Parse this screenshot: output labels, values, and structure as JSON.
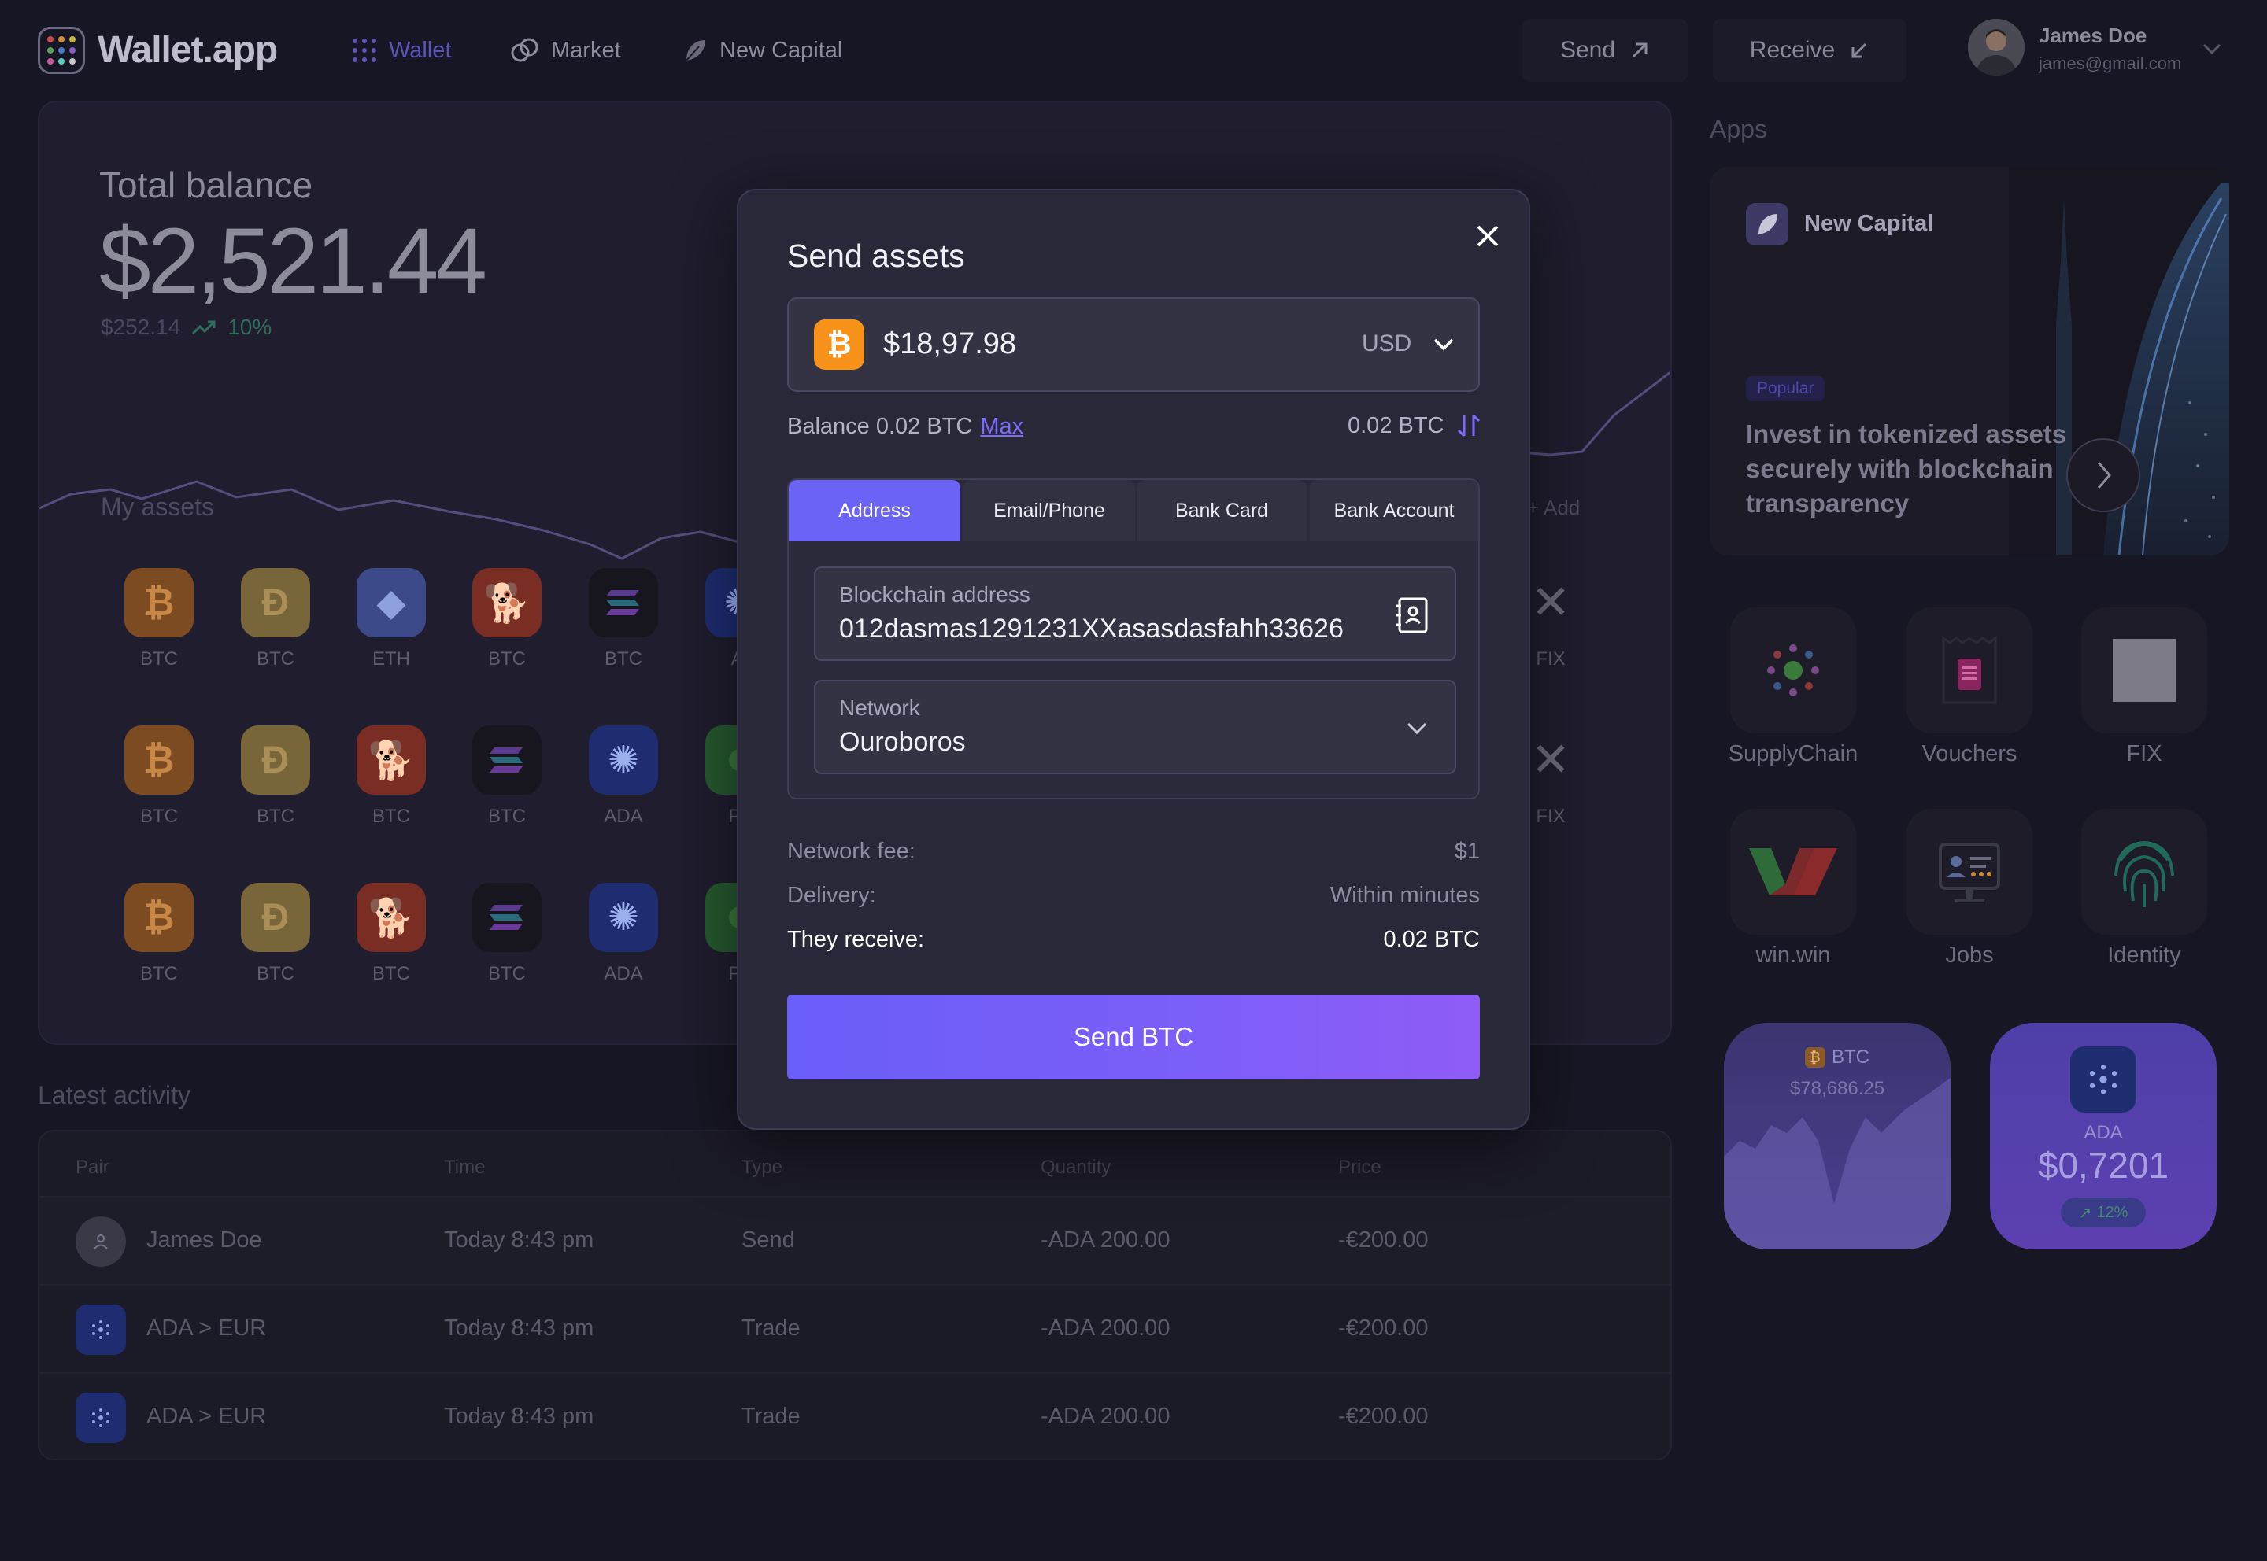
{
  "header": {
    "app_name": "Wallet.app",
    "nav": [
      {
        "label": "Wallet",
        "active": true,
        "icon": "grid-icon"
      },
      {
        "label": "Market",
        "active": false,
        "icon": "rings-icon"
      },
      {
        "label": "New Capital",
        "active": false,
        "icon": "leaf-icon"
      }
    ],
    "send_label": "Send",
    "receive_label": "Receive",
    "user": {
      "name": "James Doe",
      "email": "james@gmail.com"
    }
  },
  "balance": {
    "label": "Total balance",
    "value": "$2,521.44",
    "change_value": "$252.14",
    "change_pct": "10%"
  },
  "assets": {
    "title": "My assets",
    "add_label": "Add",
    "rows": [
      [
        {
          "symbol": "BTC",
          "icon": "bitcoin-icon",
          "kind": "btc"
        },
        {
          "symbol": "BTC",
          "icon": "dogecoin-icon",
          "kind": "doge"
        },
        {
          "symbol": "ETH",
          "icon": "ethereum-icon",
          "kind": "eth"
        },
        {
          "symbol": "BTC",
          "icon": "shiba-icon",
          "kind": "shib"
        },
        {
          "symbol": "BTC",
          "icon": "solana-icon",
          "kind": "sol"
        },
        {
          "symbol": "AI",
          "icon": "cardano-icon",
          "kind": "ada"
        }
      ],
      [
        {
          "symbol": "BTC",
          "icon": "bitcoin-icon",
          "kind": "btc"
        },
        {
          "symbol": "BTC",
          "icon": "dogecoin-icon",
          "kind": "doge"
        },
        {
          "symbol": "BTC",
          "icon": "shiba-icon",
          "kind": "shib"
        },
        {
          "symbol": "BTC",
          "icon": "solana-icon",
          "kind": "sol"
        },
        {
          "symbol": "ADA",
          "icon": "cardano-icon",
          "kind": "ada"
        },
        {
          "symbol": "Pe",
          "icon": "pe-icon",
          "kind": "pe"
        }
      ],
      [
        {
          "symbol": "BTC",
          "icon": "bitcoin-icon",
          "kind": "btc"
        },
        {
          "symbol": "BTC",
          "icon": "dogecoin-icon",
          "kind": "doge"
        },
        {
          "symbol": "BTC",
          "icon": "shiba-icon",
          "kind": "shib"
        },
        {
          "symbol": "BTC",
          "icon": "solana-icon",
          "kind": "sol"
        },
        {
          "symbol": "ADA",
          "icon": "cardano-icon",
          "kind": "ada"
        },
        {
          "symbol": "Pe",
          "icon": "pe-icon",
          "kind": "pe"
        }
      ]
    ],
    "right_col": [
      {
        "symbol": "FIX",
        "icon": "fix-icon"
      },
      {
        "symbol": "FIX",
        "icon": "fix-icon"
      }
    ]
  },
  "activity": {
    "title": "Latest activity",
    "columns": [
      "Pair",
      "Time",
      "Type",
      "Quantity",
      "Price"
    ],
    "rows": [
      {
        "pair": "James Doe",
        "time": "Today 8:43 pm",
        "type": "Send",
        "quantity": "-ADA 200.00",
        "price": "-€200.00",
        "avatar": "user-icon"
      },
      {
        "pair": "ADA > EUR",
        "time": "Today 8:43 pm",
        "type": "Trade",
        "quantity": "-ADA 200.00",
        "price": "-€200.00",
        "avatar": "cardano-icon"
      },
      {
        "pair": "ADA > EUR",
        "time": "Today 8:43 pm",
        "type": "Trade",
        "quantity": "-ADA 200.00",
        "price": "-€200.00",
        "avatar": "cardano-icon"
      }
    ]
  },
  "apps": {
    "title": "Apps",
    "featured": {
      "brand": "New Capital",
      "badge": "Popular",
      "headline": "Invest in tokenized assets securely with blockchain transparency"
    },
    "tiles": [
      {
        "label": "SupplyChain",
        "icon": "supplychain-icon"
      },
      {
        "label": "Vouchers",
        "icon": "voucher-icon"
      },
      {
        "label": "FIX",
        "icon": "fix-square-icon"
      },
      {
        "label": "win.win",
        "icon": "winwin-icon"
      },
      {
        "label": "Jobs",
        "icon": "jobs-icon"
      },
      {
        "label": "Identity",
        "icon": "fingerprint-icon"
      }
    ],
    "tickers": [
      {
        "symbol": "BTC",
        "price": "$78,686.25"
      },
      {
        "symbol": "ADA",
        "price": "$0,7201",
        "change": "12%"
      }
    ]
  },
  "modal": {
    "title": "Send assets",
    "amount": "$18,97.98",
    "currency": "USD",
    "balance_label": "Balance 0.02 BTC",
    "max_label": "Max",
    "converted": "0.02 BTC",
    "tabs": [
      "Address",
      "Email/Phone",
      "Bank Card",
      "Bank Account"
    ],
    "active_tab": "Address",
    "address_label": "Blockchain address",
    "address_value": "012dasmas1291231XXasasdasfahh33626",
    "network_label": "Network",
    "network_value": "Ouroboros",
    "fees": [
      {
        "label": "Network fee:",
        "value": "$1"
      },
      {
        "label": "Delivery:",
        "value": "Within minutes"
      },
      {
        "label": "They receive:",
        "value": "0.02 BTC"
      }
    ],
    "submit_label": "Send BTC"
  },
  "colors": {
    "background": "#171624",
    "accent": "#6a63f6",
    "bitcoin": "#f7931a",
    "positive": "#2f6d5c"
  }
}
